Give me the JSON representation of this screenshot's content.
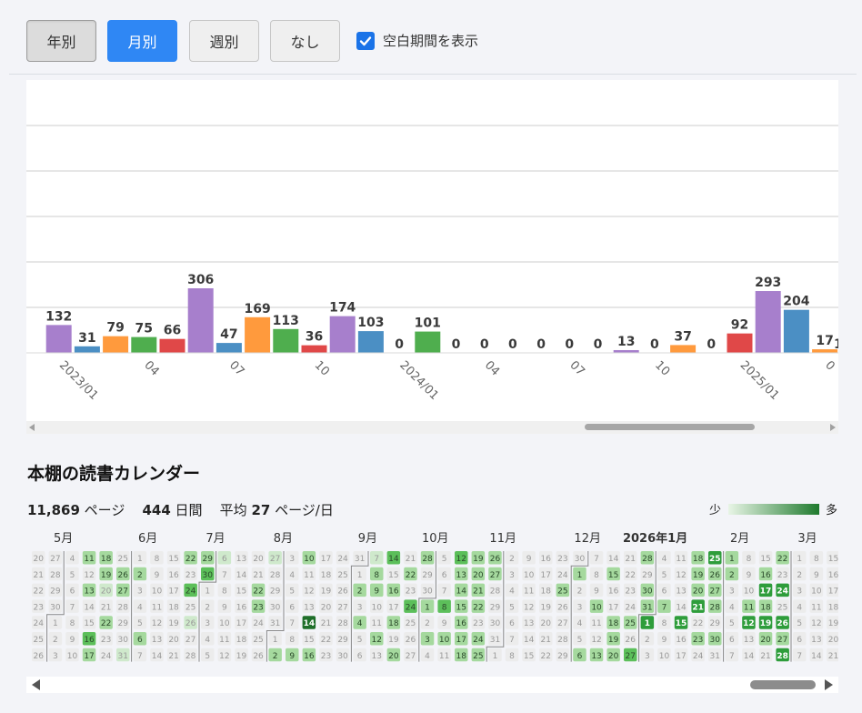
{
  "toolbar": {
    "buttons": [
      {
        "label": "年別",
        "state": "pressed"
      },
      {
        "label": "月別",
        "state": "active"
      },
      {
        "label": "週別",
        "state": "normal"
      },
      {
        "label": "なし",
        "state": "normal"
      }
    ],
    "show_blank_label": "空白期間を表示",
    "show_blank_checked": true
  },
  "chart_data": {
    "type": "bar",
    "categories": [
      "2022/12",
      "2023/01",
      "2023/02",
      "2023/03",
      "2023/04",
      "2023/05",
      "2023/06",
      "2023/07",
      "2023/08",
      "2023/09",
      "2023/10",
      "2023/11",
      "2023/12",
      "2024/01",
      "2024/02",
      "2024/03",
      "2024/04",
      "2024/05",
      "2024/06",
      "2024/07",
      "2024/08",
      "2024/09",
      "2024/10",
      "2024/11",
      "2024/12",
      "2025/01",
      "2025/02",
      "2025/03",
      "2025/04"
    ],
    "values": [
      null,
      132,
      31,
      79,
      75,
      66,
      306,
      47,
      169,
      113,
      36,
      174,
      103,
      0,
      101,
      0,
      0,
      0,
      0,
      0,
      0,
      13,
      0,
      37,
      0,
      92,
      293,
      204,
      17
    ],
    "value_labels": [
      "",
      "132",
      "31",
      "79",
      "75",
      "66",
      "306",
      "47",
      "169",
      "113",
      "36",
      "174",
      "103",
      "0",
      "101",
      "0",
      "0",
      "0",
      "0",
      "0",
      "0",
      "13",
      "0",
      "37",
      "0",
      "92",
      "293",
      "204",
      "17"
    ],
    "x_tick_labels": [
      "2023/01",
      "04",
      "07",
      "10",
      "2024/01",
      "04",
      "07",
      "10",
      "2025/01",
      "0"
    ],
    "partial_edge_label": "1",
    "palette": [
      "#a77fcc",
      "#4b8fc4",
      "#ff9a3d",
      "#4fae4e",
      "#e04848"
    ],
    "grid": true,
    "xlabel": "",
    "ylabel": ""
  },
  "calendar": {
    "title": "本棚の読書カレンダー",
    "stats": {
      "pages_value": "11,869",
      "pages_unit": "ページ",
      "days_value": "444",
      "days_unit": "日間",
      "avg_prefix": "平均",
      "avg_value": "27",
      "avg_unit": "ページ/日"
    },
    "legend_low": "少",
    "legend_high": "多",
    "months": [
      {
        "label": "5月",
        "bold": false
      },
      {
        "label": "6月",
        "bold": false
      },
      {
        "label": "7月",
        "bold": false
      },
      {
        "label": "8月",
        "bold": false
      },
      {
        "label": "9月",
        "bold": false
      },
      {
        "label": "10月",
        "bold": false
      },
      {
        "label": "11月",
        "bold": false
      },
      {
        "label": "12月",
        "bold": false
      },
      {
        "label": "2026年1月",
        "bold": true
      },
      {
        "label": "2月",
        "bold": false
      },
      {
        "label": "3月",
        "bold": false
      }
    ],
    "grid_start": "2025-04-20",
    "grid_end": "2026-03-28",
    "level_colors": [
      "#ececec",
      "#cfe9cc",
      "#a5d99e",
      "#5cbf5a",
      "#2e9d3b",
      "#1f6f2a"
    ],
    "activity": {
      "2025-05-11": 2,
      "2025-05-13": 2,
      "2025-05-16": 3,
      "2025-05-17": 2,
      "2025-05-18": 2,
      "2025-05-19": 2,
      "2025-05-20": 1,
      "2025-05-22": 2,
      "2025-05-26": 2,
      "2025-05-27": 2,
      "2025-05-31": 1,
      "2025-06-02": 2,
      "2025-06-06": 2,
      "2025-06-22": 2,
      "2025-06-24": 3,
      "2025-06-26": 1,
      "2025-06-29": 2,
      "2025-06-30": 3,
      "2025-07-06": 1,
      "2025-07-22": 2,
      "2025-07-23": 2,
      "2025-07-27": 1,
      "2025-08-02": 2,
      "2025-08-09": 2,
      "2025-08-10": 2,
      "2025-08-14": 5,
      "2025-08-16": 2,
      "2025-09-02": 2,
      "2025-09-04": 2,
      "2025-09-07": 1,
      "2025-09-08": 2,
      "2025-09-09": 2,
      "2025-09-12": 2,
      "2025-09-14": 3,
      "2025-09-16": 2,
      "2025-09-18": 2,
      "2025-09-20": 2,
      "2025-09-22": 2,
      "2025-09-24": 3,
      "2025-09-28": 2,
      "2025-10-01": 2,
      "2025-10-03": 2,
      "2025-10-08": 3,
      "2025-10-10": 2,
      "2025-10-12": 3,
      "2025-10-13": 2,
      "2025-10-14": 2,
      "2025-10-15": 2,
      "2025-10-16": 2,
      "2025-10-17": 2,
      "2025-10-18": 2,
      "2025-10-19": 2,
      "2025-10-20": 2,
      "2025-10-21": 2,
      "2025-10-22": 2,
      "2025-10-24": 2,
      "2025-10-25": 2,
      "2025-10-26": 2,
      "2025-10-27": 2,
      "2025-11-25": 2,
      "2025-12-01": 2,
      "2025-12-06": 2,
      "2025-12-10": 2,
      "2025-12-13": 2,
      "2025-12-15": 2,
      "2025-12-18": 2,
      "2025-12-19": 2,
      "2025-12-20": 2,
      "2025-12-25": 2,
      "2025-12-27": 3,
      "2025-12-28": 2,
      "2025-12-30": 2,
      "2025-12-31": 2,
      "2026-01-01": 4,
      "2026-01-07": 2,
      "2026-01-15": 4,
      "2026-01-18": 2,
      "2026-01-19": 2,
      "2026-01-20": 2,
      "2026-01-21": 4,
      "2026-01-23": 2,
      "2026-01-25": 4,
      "2026-01-26": 2,
      "2026-01-27": 2,
      "2026-01-28": 2,
      "2026-01-30": 2,
      "2026-02-01": 2,
      "2026-02-02": 2,
      "2026-02-11": 2,
      "2026-02-12": 4,
      "2026-02-16": 2,
      "2026-02-17": 4,
      "2026-02-18": 2,
      "2026-02-19": 4,
      "2026-02-20": 2,
      "2026-02-22": 2,
      "2026-02-24": 4,
      "2026-02-26": 4,
      "2026-02-27": 2,
      "2026-02-28": 4
    }
  }
}
